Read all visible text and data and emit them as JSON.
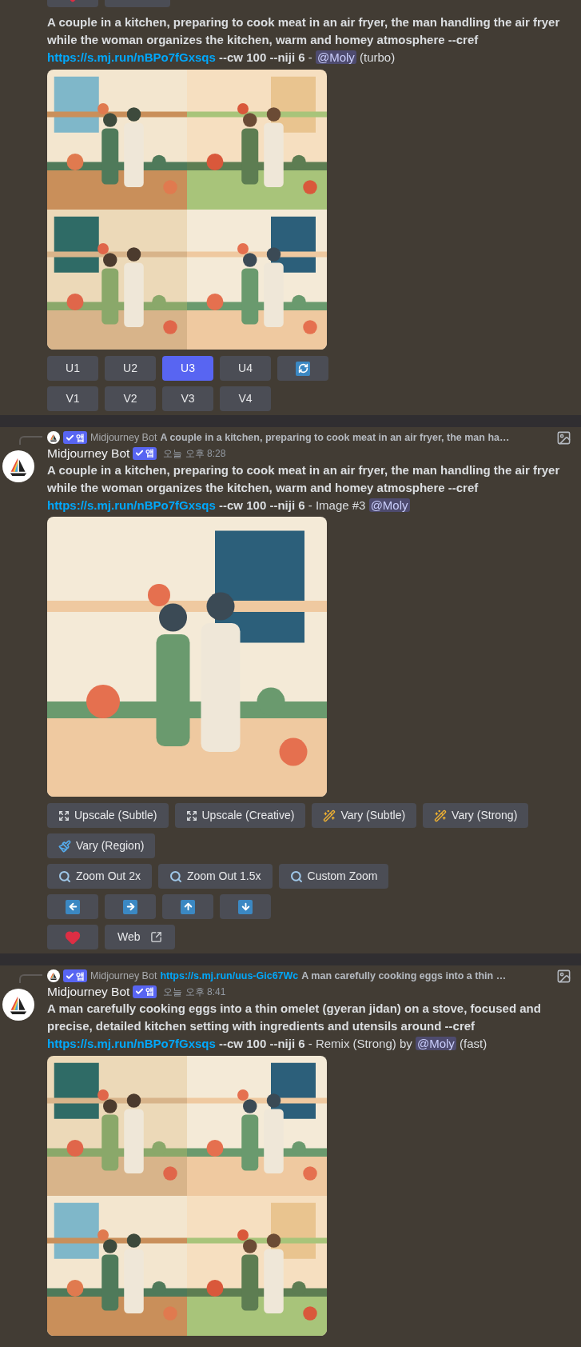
{
  "partial_row": [
    {
      "kind": "heart"
    },
    {
      "kind": "web"
    }
  ],
  "messages": [
    {
      "prompt": "A couple in a kitchen, preparing to cook meat in an air fryer, the man handling the air fryer while the woman organizes the kitchen, warm and homey atmosphere --cref",
      "link": "https://s.mj.run/nBPo7fGxsqs",
      "params": "--cw 100 --niji 6",
      "suffix": "-",
      "mention": "@Moly",
      "tail": "(turbo)",
      "images": [
        {
          "kind": "picture"
        },
        {
          "kind": "picture"
        },
        {
          "kind": "picture"
        },
        {
          "kind": "picture"
        }
      ],
      "button_rows": [
        [
          {
            "kind": "text",
            "label": "U1",
            "selected": false
          },
          {
            "kind": "text",
            "label": "U2",
            "selected": false
          },
          {
            "kind": "text",
            "label": "U3",
            "selected": true
          },
          {
            "kind": "text",
            "label": "U4",
            "selected": false
          },
          {
            "kind": "refresh",
            "selected": false
          }
        ],
        [
          {
            "kind": "text",
            "label": "V1",
            "selected": false
          },
          {
            "kind": "text",
            "label": "V2",
            "selected": false
          },
          {
            "kind": "text",
            "label": "V3",
            "selected": false
          },
          {
            "kind": "text",
            "label": "V4",
            "selected": false
          }
        ]
      ]
    },
    {
      "reply": {
        "author": "Midjourney Bot",
        "badge": "앱",
        "text": "A couple in a kitchen, preparing to cook meat in an air fryer, the man ha…"
      },
      "author": "Midjourney Bot",
      "badge": "앱",
      "time": "오늘 오후 8:28",
      "prompt": "A couple in a kitchen, preparing to cook meat in an air fryer, the man handling the air fryer while the woman organizes the kitchen, warm and homey atmosphere --cref",
      "link": "https://s.mj.run/nBPo7fGxsqs",
      "params": "--cw 100 --niji 6",
      "suffix": "- Image #3",
      "mention": "@Moly",
      "images": [
        {
          "kind": "picture"
        }
      ],
      "button_rows": [
        [
          {
            "kind": "upscale",
            "label": "Upscale (Subtle)"
          },
          {
            "kind": "upscale",
            "label": "Upscale (Creative)"
          },
          {
            "kind": "vary",
            "label": "Vary (Subtle)"
          },
          {
            "kind": "vary",
            "label": "Vary (Strong)"
          }
        ],
        [
          {
            "kind": "region",
            "label": "Vary (Region)"
          }
        ],
        [
          {
            "kind": "zoom",
            "label": "Zoom Out 2x"
          },
          {
            "kind": "zoom",
            "label": "Zoom Out 1.5x"
          },
          {
            "kind": "zoom",
            "label": "Custom Zoom"
          }
        ],
        [
          {
            "kind": "left"
          },
          {
            "kind": "right"
          },
          {
            "kind": "up"
          },
          {
            "kind": "down"
          }
        ],
        [
          {
            "kind": "heart"
          },
          {
            "kind": "web",
            "label": "Web"
          }
        ]
      ]
    },
    {
      "reply": {
        "author": "Midjourney Bot",
        "badge": "앱",
        "link": "https://s.mj.run/uus-Gic67Wc",
        "text": "A man carefully cooking eggs into a thin …"
      },
      "author": "Midjourney Bot",
      "badge": "앱",
      "time": "오늘 오후 8:41",
      "prompt": "A man carefully cooking eggs into a thin omelet (gyeran jidan) on a stove, focused and precise, detailed kitchen setting with ingredients and utensils around --cref",
      "link": "https://s.mj.run/nBPo7fGxsqs",
      "params": "--cw 100 --niji 6",
      "suffix": "- Remix (Strong) by",
      "mention": "@Moly",
      "tail": "(fast)",
      "images": [
        {
          "kind": "picture"
        },
        {
          "kind": "picture"
        },
        {
          "kind": "picture"
        },
        {
          "kind": "picture"
        }
      ]
    }
  ]
}
